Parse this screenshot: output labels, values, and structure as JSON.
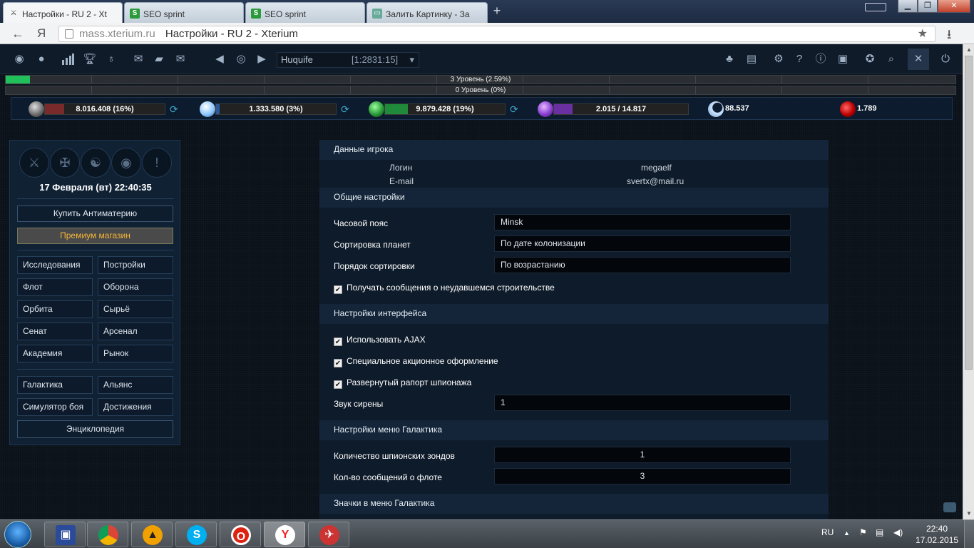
{
  "browser": {
    "tabs": [
      {
        "label": "Настройки - RU 2 - Xt",
        "icon": "xterium-icon",
        "active": true
      },
      {
        "label": "SEO sprint",
        "icon": "seosprint-icon",
        "active": false
      },
      {
        "label": "SEO sprint",
        "icon": "seosprint-icon",
        "active": false
      },
      {
        "label": "Залить Картинку - За",
        "icon": "image-upload-icon",
        "active": false
      }
    ],
    "url_host": "mass.xterium.ru",
    "url_title": "Настройки - RU 2 - Xterium",
    "yandex_glyph": "Я"
  },
  "game_nav": {
    "planet_name": "Huquife",
    "coords": "[1:2831:15]"
  },
  "levels": [
    {
      "text": "3 Уровень (2.59%)",
      "progress": 0.0259
    },
    {
      "text": "0 Уровень (0%)",
      "progress": 0
    }
  ],
  "resources": [
    {
      "name": "metal",
      "text": "8.016.408 (16%)",
      "fill": 0.16,
      "color": "#7a2a2a"
    },
    {
      "name": "crystal",
      "text": "1.333.580 (3%)",
      "fill": 0.03,
      "color": "#2a5a9a"
    },
    {
      "name": "deuterium",
      "text": "9.879.428 (19%)",
      "fill": 0.19,
      "color": "#1f8a3a"
    },
    {
      "name": "energy",
      "text": "2.015 / 14.817",
      "fill": 0.136,
      "color": "#6a2fa0"
    },
    {
      "name": "darkmatter",
      "text": "88.537"
    },
    {
      "name": "antimatter",
      "text": "1.789"
    }
  ],
  "sidebar": {
    "datetime": "17 Февраля (вт) 22:40:35",
    "buy_antimatter": "Купить Антиматерию",
    "premium_shop": "Премиум магазин",
    "menu": [
      {
        "label": "Исследования"
      },
      {
        "label": "Постройки"
      },
      {
        "label": "Флот"
      },
      {
        "label": "Оборона"
      },
      {
        "label": "Орбита"
      },
      {
        "label": "Сырьё"
      },
      {
        "label": "Сенат"
      },
      {
        "label": "Арсенал"
      },
      {
        "label": "Академия"
      },
      {
        "label": "Рынок"
      }
    ],
    "menu2": [
      {
        "label": "Галактика"
      },
      {
        "label": "Альянс"
      },
      {
        "label": "Симулятор боя"
      },
      {
        "label": "Достижения"
      }
    ],
    "encyclopedia": "Энциклопедия"
  },
  "settings": {
    "player_section": "Данные игрока",
    "login_label": "Логин",
    "login_value": "megaelf",
    "email_label": "E-mail",
    "email_value": "svertx@mail.ru",
    "general_section": "Общие настройки",
    "timezone_label": "Часовой пояс",
    "timezone_value": "Minsk",
    "sort_planets_label": "Сортировка планет",
    "sort_planets_value": "По дате колонизации",
    "sort_order_label": "Порядок сортировки",
    "sort_order_value": "По возрастанию",
    "build_fail_msg": "Получать сообщения о неудавшемся строительстве",
    "interface_section": "Настройки интерфейса",
    "use_ajax": "Использовать AJAX",
    "special_design": "Специальное акционное оформление",
    "expanded_spy": "Развернутый рапорт шпионажа",
    "siren_label": "Звук сирены",
    "siren_value": "1",
    "galaxy_section": "Настройки меню Галактика",
    "probes_label": "Количество шпионских зондов",
    "probes_value": "1",
    "fleet_msgs_label": "Кол-во сообщений о флоте",
    "fleet_msgs_value": "3",
    "galaxy_icons_section": "Значки в меню Галактика"
  },
  "taskbar": {
    "lang": "RU",
    "time": "22:40",
    "date": "17.02.2015"
  }
}
